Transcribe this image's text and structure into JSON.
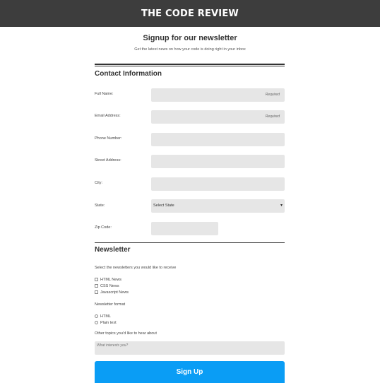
{
  "header": {
    "site_title": "THE CODE REVIEW"
  },
  "intro": {
    "title": "Signup for our newsletter",
    "subtitle": "Get the latest news on how your code is doing right in your inbox"
  },
  "contact": {
    "heading": "Contact Information",
    "fields": [
      {
        "label": "Full Name:",
        "hint": "Required"
      },
      {
        "label": "Email Address:",
        "hint": "Required"
      },
      {
        "label": "Phone Number:"
      },
      {
        "label": "Street Address:"
      },
      {
        "label": "City:"
      },
      {
        "label": "State:",
        "selected": "Select State"
      },
      {
        "label": "Zip Code:"
      }
    ]
  },
  "newsletter": {
    "heading": "Newsletter",
    "select_prompt": "Select the newsletters you would like to receive",
    "newsletters": [
      "HTML News",
      "CSS News",
      "Javascript News"
    ],
    "format_label": "Newsletter format",
    "formats": [
      "HTML",
      "Plain text"
    ],
    "topics_label": "Other topics you'd like to hear about",
    "topics_placeholder": "What interests you?"
  },
  "submit_label": "Sign Up",
  "colors": {
    "header_bg": "#3d3d3d",
    "button_bg": "#0a9df5",
    "input_bg": "#e6e6e6"
  }
}
